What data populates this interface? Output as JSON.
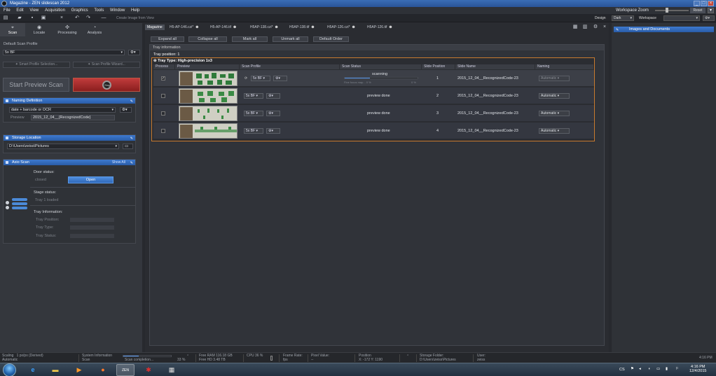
{
  "window": {
    "title": "Magazine - ZEN slidescan 2012"
  },
  "menu": [
    "File",
    "Edit",
    "View",
    "Acquisition",
    "Graphics",
    "Tools",
    "Window",
    "Help"
  ],
  "workspace_zoom": {
    "label": "Workspace Zoom",
    "reset": "Reset"
  },
  "toolbar": {
    "create_image_from_view": "Create Image from View",
    "design_label": "Design",
    "design_value": "Dark",
    "workspace_label": "Workspace",
    "workspace_value": ""
  },
  "left_tabs": [
    {
      "label": "Scan",
      "icon": "scan-icon"
    },
    {
      "label": "Locate",
      "icon": "locate-icon"
    },
    {
      "label": "Processing",
      "icon": "processing-icon"
    },
    {
      "label": "Analysis",
      "icon": "analysis-icon"
    }
  ],
  "scan": {
    "default_profile_label": "Default Scan Profile",
    "default_profile_value": "5x BF",
    "smart_profile": "Smart Profile Selection...",
    "profile_wizard": "Scan Profile Wizard...",
    "start_preview": "Start Preview Scan",
    "stop": "Stop"
  },
  "naming": {
    "header": "Naming Definition",
    "value": "date + barcode or OCR",
    "preview_label": "Preview",
    "preview_value": "2015_12_04__{RecognizedCode}"
  },
  "storage": {
    "header": "Storage Location",
    "path": "D:\\Users\\zeiss\\Pictures"
  },
  "axio": {
    "header": "Axio Scan",
    "show_all": "Show All",
    "door_status_label": "Door status:",
    "door_status_value": "closed",
    "open_button": "Open",
    "stage_status_label": "Stage status:",
    "stage_status_value": "Tray 1 loaded",
    "tray_info_label": "Tray Information:",
    "tray_position_label": "Tray Position:",
    "tray_type_label": "Tray Type:",
    "tray_status_label": "Tray Status:"
  },
  "doc_tabs": [
    {
      "label": "Magazine",
      "active": true,
      "closable": false
    },
    {
      "label": "H5-AP-146.czi*",
      "active": false,
      "closable": true
    },
    {
      "label": "H5-AP-146.tif",
      "active": false,
      "closable": true
    },
    {
      "label": "H5AP-138.czi*",
      "active": false,
      "closable": true
    },
    {
      "label": "H5AP-138.tif",
      "active": false,
      "closable": true
    },
    {
      "label": "H5AP-126.czi*",
      "active": false,
      "closable": true
    },
    {
      "label": "H5AP-126.tif",
      "active": false,
      "closable": true
    }
  ],
  "actions": {
    "expand_all": "Expand all",
    "collapse_all": "Collapse all",
    "mark_all": "Mark all",
    "unmark_all": "Unmark all",
    "default_order": "Default Order"
  },
  "tray": {
    "info_header": "Tray information",
    "position_label": "Tray position:",
    "position_value": "1",
    "type_label": "Tray Type:",
    "type_value": "High-precision 1x3",
    "columns": [
      "Process",
      "Preview",
      "Scan Profile",
      "Scan Status",
      "Slide Position",
      "Slide Name",
      "Naming"
    ],
    "rows": [
      {
        "checked": true,
        "profile": "5x BF",
        "status": "scanning",
        "substatus": "Fine focus map... 0 %",
        "progress_pct": "0 %",
        "progress": 0.35,
        "position": "1",
        "name": "2015_12_04__RecognizedCode-23",
        "naming": "Automatic",
        "selected": true
      },
      {
        "checked": false,
        "profile": "5x BF",
        "status": "preview done",
        "substatus": "",
        "progress_pct": "",
        "progress": 0,
        "position": "2",
        "name": "2015_12_04__RecognizedCode-23",
        "naming": "Automatic",
        "selected": false
      },
      {
        "checked": false,
        "profile": "5x BF",
        "status": "preview done",
        "substatus": "",
        "progress_pct": "",
        "progress": 0,
        "position": "3",
        "name": "2015_12_04__RecognizedCode-23",
        "naming": "Automatic",
        "selected": false
      },
      {
        "checked": false,
        "profile": "5x BF",
        "status": "preview done",
        "substatus": "",
        "progress_pct": "",
        "progress": 0,
        "position": "4",
        "name": "2015_12_04__RecognizedCode-23",
        "naming": "Automatic",
        "selected": false
      }
    ]
  },
  "right_panel": {
    "images_docs": "Images and Documents"
  },
  "statusbar": {
    "scaling_label": "Scaling",
    "scaling_value": "1 px/px (Derived)",
    "scaling_sub": "Automatic",
    "sysinfo_label": "System Information",
    "sysinfo_sub": "Scan",
    "scan_completion": "Scan completion...",
    "scan_pct": "33 %",
    "scan_progress": 0.33,
    "free_ram": "Free RAM 116.18 GB",
    "free_hd": "Free HD   3.48 TB",
    "cpu": "CPU 36 %",
    "frame_rate_label": "Frame Rate:",
    "frame_rate_unit": "fps",
    "pixel_value_label": "Pixel Value:",
    "pixel_value": "--",
    "position_label": "Position",
    "position_value": "X: -172  Y: 1190",
    "storage_label": "Storage Folder:",
    "storage_value": "D:\\Users\\zeiss\\Pictures",
    "user_label": "User:",
    "user_value": "zeiss",
    "time": "4:16 PM"
  },
  "taskbar": {
    "time": "4:16 PM",
    "date": "12/4/2015",
    "lang": "CS"
  },
  "colors": {
    "accent": "#3d7ad0",
    "highlight": "#c87a2e",
    "stop": "#c13c3c"
  }
}
